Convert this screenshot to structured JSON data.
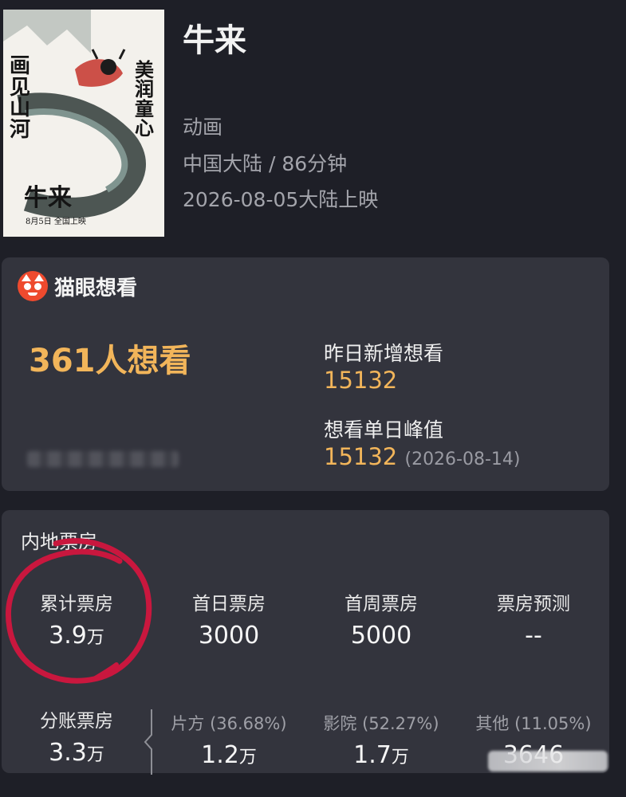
{
  "movie": {
    "title": "牛来",
    "genre": "动画",
    "region_duration": "中国大陆 / 86分钟",
    "release": "2026-08-05大陆上映",
    "poster": {
      "left_text": "画见山河",
      "right_text": "美润童心",
      "name": "牛来",
      "date_line": "8月5日 全国上映"
    }
  },
  "maoyan": {
    "brand": "猫眼想看",
    "want_count": "361人想看",
    "daily_new_label": "昨日新增想看",
    "daily_new_value": "15132",
    "peak_label": "想看单日峰值",
    "peak_value": "15132",
    "peak_date": "(2026-08-14)"
  },
  "box_office": {
    "section_title": "内地票房",
    "stats": [
      {
        "label": "累计票房",
        "value": "3.9",
        "unit": "万"
      },
      {
        "label": "首日票房",
        "value": "3000",
        "unit": ""
      },
      {
        "label": "首周票房",
        "value": "5000",
        "unit": ""
      },
      {
        "label": "票房预测",
        "value": "--",
        "unit": ""
      }
    ],
    "split": {
      "label": "分账票房",
      "value": "3.3",
      "unit": "万"
    },
    "breakdown": [
      {
        "label": "片方 (36.68%)",
        "value": "1.2",
        "unit": "万"
      },
      {
        "label": "影院 (52.27%)",
        "value": "1.7",
        "unit": "万"
      },
      {
        "label": "其他 (11.05%)",
        "value": "3646",
        "unit": ""
      }
    ]
  },
  "colors": {
    "accent": "#f2b55a",
    "brand_red": "#ee4a2e",
    "highlight_circle": "#c9173e"
  }
}
